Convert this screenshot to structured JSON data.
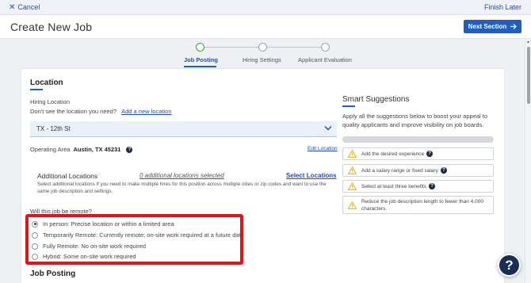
{
  "topbar": {
    "cancel_label": "Cancel",
    "finish_label": "Finish Later"
  },
  "header": {
    "title": "Create New Job",
    "next_label": "Next Section"
  },
  "stepper": {
    "steps": [
      {
        "label": "Job Posting",
        "active": true
      },
      {
        "label": "Hiring Settings",
        "active": false
      },
      {
        "label": "Applicant Evaluation",
        "active": false
      }
    ]
  },
  "location": {
    "section_title": "Location",
    "hiring_location_label": "Hiring Location",
    "not_seeing_text": "Don't see the location you need?",
    "add_location_link": "Add a new location",
    "selected_location": "TX - 12th St",
    "operating_area_label": "Operating Area",
    "operating_area_value": "Austin, TX 45231",
    "edit_location_link": "Edit Location",
    "additional_title": "Additional Locations",
    "additional_count": "0 additional locations selected",
    "select_locations_link": "Select Locations",
    "additional_desc_line1": "Select additional locations if you need to make multiple hires for this position across multiple cities or zip codes and want to use the",
    "additional_desc_line2": "same job description and settings.",
    "remote_question": "Will this job be remote?",
    "remote_options": [
      {
        "label": "In person: Precise location or within a limited area",
        "selected": true
      },
      {
        "label": "Temporarily Remote: Currently remote; on-site work required at a future date",
        "selected": false
      },
      {
        "label": "Fully Remote: No on-site work required",
        "selected": false
      },
      {
        "label": "Hybrid: Some on-site work required",
        "selected": false
      }
    ]
  },
  "job_posting": {
    "section_title": "Job Posting"
  },
  "smart": {
    "title": "Smart Suggestions",
    "desc_line1": "Apply all the suggestions below to boost your appeal to",
    "desc_line2": "quality applicants and improve visibility on job boards.",
    "progress": 0,
    "suggestions": [
      {
        "text": "Add the desired experience"
      },
      {
        "text": "Add a salary range or fixed salary"
      },
      {
        "text": "Select at least three benefits"
      },
      {
        "text_line1": "Reduce the job description length to fewer than 4,000",
        "text_line2": "characters."
      }
    ]
  },
  "fab": {
    "label": "?"
  },
  "colors": {
    "accent": "#1f5fbf",
    "highlight": "#e0151b",
    "step_active": "#3a9b4c",
    "warning": "#e8b42a"
  }
}
